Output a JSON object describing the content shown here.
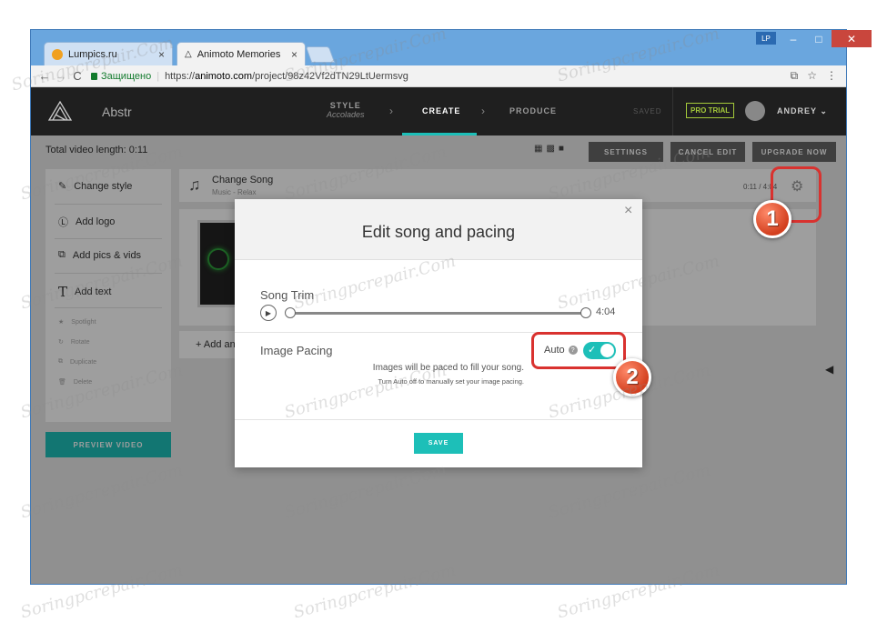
{
  "browser": {
    "tabs": [
      {
        "label": "Lumpics.ru",
        "close": "×"
      },
      {
        "label": "Animoto Memories",
        "close": "×"
      }
    ],
    "profile_badge": "LP",
    "window_controls": {
      "minimize": "–",
      "maximize": "□",
      "close": "✕"
    },
    "nav": {
      "back": "←",
      "forward": "→",
      "reload": "C"
    },
    "secure_label": "Защищено",
    "url_scheme": "https://",
    "url_domain": "animoto.com",
    "url_path": "/project/98z42Vf2dTN29LtUermsvg",
    "right_icons": {
      "translate": "⧉",
      "star": "☆",
      "menu": "⋮"
    }
  },
  "app_header": {
    "project_name": "Abstr",
    "step_style_label": "STYLE",
    "step_style_value": "Accolades",
    "step_create_label": "CREATE",
    "step_produce_label": "PRODUCE",
    "step_arrow": "›",
    "saved_label": "SAVED",
    "pro_trial_label": "PRO TRIAL",
    "user_name": "ANDREY",
    "user_chevron": "⌄"
  },
  "toolbar": {
    "total_length": "Total video length: 0:11",
    "settings_label": "SETTINGS",
    "cancel_edit_label": "CANCEL EDIT",
    "upgrade_label": "UPGRADE NOW"
  },
  "sidebar": {
    "items": [
      {
        "label": "Change style",
        "icon": "✎"
      },
      {
        "label": "Add logo",
        "icon": "Ⓛ"
      },
      {
        "label": "Add pics & vids",
        "icon": "⧉"
      },
      {
        "label": "Add text",
        "icon": "T"
      },
      {
        "label": "Spotlight",
        "icon": "★"
      },
      {
        "label": "Rotate",
        "icon": "↻"
      },
      {
        "label": "Duplicate",
        "icon": "⧉"
      },
      {
        "label": "Delete",
        "icon": "🗑"
      }
    ],
    "preview_label": "PREVIEW VIDEO"
  },
  "song_row": {
    "title": "Change Song",
    "subtitle": "Music - Relax",
    "time": "0:11 / 4:04",
    "note_icon": "♫",
    "gear_icon": "⚙"
  },
  "add_text_label": "+ Add an",
  "modal": {
    "title": "Edit song and pacing",
    "close": "×",
    "song_trim_label": "Song Trim",
    "play_icon": "▶",
    "trim_end_time": "4:04",
    "image_pacing_label": "Image Pacing",
    "auto_label": "Auto",
    "help_icon": "?",
    "auto_enabled": true,
    "check_icon": "✓",
    "pacing_description": "Images will be paced to fill your song.",
    "pacing_note": "Turn Auto off to manually set your image pacing.",
    "save_label": "SAVE"
  },
  "annotations": {
    "badge_1": "1",
    "badge_2": "2"
  },
  "watermark_text": "Soringpcrepair.Com",
  "colors": {
    "accent": "#1dbfb8",
    "highlight": "#d9322f",
    "pro_trial": "#a4c93a",
    "header_bg": "#1f1f1f",
    "window_frame": "#5b9bd5"
  }
}
